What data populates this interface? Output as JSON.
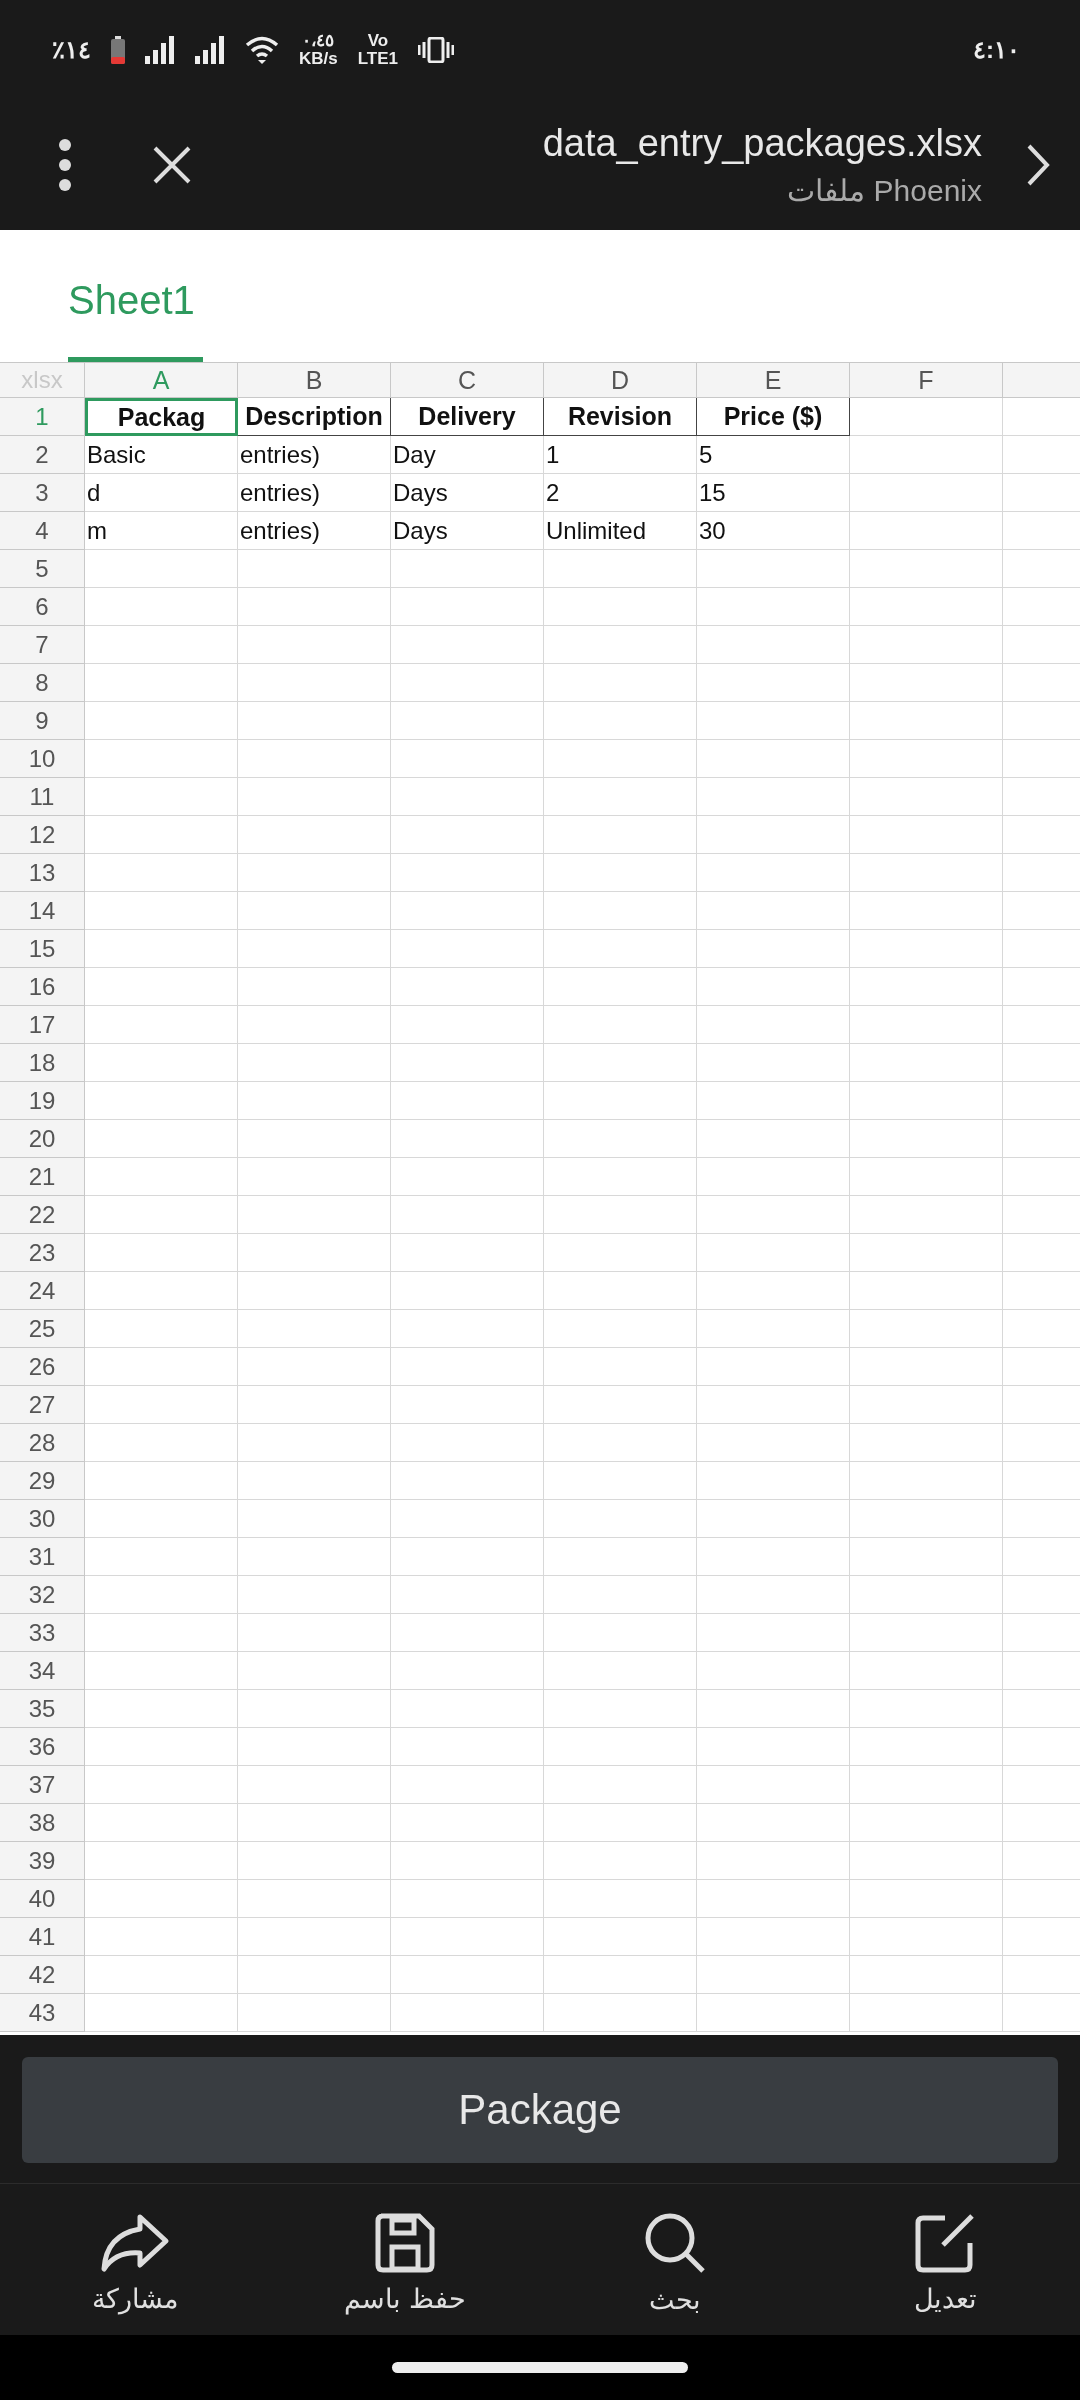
{
  "status_bar": {
    "battery_percent": "٪١٤",
    "speed": "٠،٤٥",
    "speed_unit": "KB/s",
    "volte_label": "Vo",
    "network_label": "LTE1",
    "time": "٤:١٠"
  },
  "header": {
    "title": "data_entry_packages.xlsx",
    "subtitle": "ملفات Phoenix"
  },
  "sheet_tabs": [
    {
      "label": "Sheet1",
      "selected": true
    }
  ],
  "grid": {
    "corner": "xlsx",
    "columns": [
      {
        "label": "A",
        "selected": true
      },
      {
        "label": "B",
        "selected": false
      },
      {
        "label": "C",
        "selected": false
      },
      {
        "label": "D",
        "selected": false
      },
      {
        "label": "E",
        "selected": false
      },
      {
        "label": "F",
        "selected": false
      }
    ],
    "rows": [
      {
        "number": "1",
        "selected": true,
        "kind": "header",
        "cells": [
          "Packag",
          "Description",
          "Delivery",
          "Revision",
          "Price ($)"
        ]
      },
      {
        "number": "2",
        "selected": false,
        "kind": "data",
        "cells": [
          "Basic",
          "entries)",
          "Day",
          "1",
          "5"
        ]
      },
      {
        "number": "3",
        "selected": false,
        "kind": "data",
        "cells": [
          "d",
          "entries)",
          "Days",
          "2",
          "15"
        ]
      },
      {
        "number": "4",
        "selected": false,
        "kind": "data",
        "cells": [
          "m",
          "entries)",
          "Days",
          "Unlimited",
          "30"
        ]
      },
      {
        "number": "5",
        "selected": false
      },
      {
        "number": "6",
        "selected": false
      },
      {
        "number": "7",
        "selected": false
      },
      {
        "number": "8",
        "selected": false
      },
      {
        "number": "9",
        "selected": false
      },
      {
        "number": "10",
        "selected": false
      },
      {
        "number": "11",
        "selected": false
      },
      {
        "number": "12",
        "selected": false
      },
      {
        "number": "13",
        "selected": false
      },
      {
        "number": "14",
        "selected": false
      },
      {
        "number": "15",
        "selected": false
      },
      {
        "number": "16",
        "selected": false
      },
      {
        "number": "17",
        "selected": false
      },
      {
        "number": "18",
        "selected": false
      },
      {
        "number": "19",
        "selected": false
      },
      {
        "number": "20",
        "selected": false
      },
      {
        "number": "21",
        "selected": false
      },
      {
        "number": "22",
        "selected": false
      },
      {
        "number": "23",
        "selected": false
      },
      {
        "number": "24",
        "selected": false
      },
      {
        "number": "25",
        "selected": false
      },
      {
        "number": "26",
        "selected": false
      },
      {
        "number": "27",
        "selected": false
      },
      {
        "number": "28",
        "selected": false
      },
      {
        "number": "29",
        "selected": false
      },
      {
        "number": "30",
        "selected": false
      },
      {
        "number": "31",
        "selected": false
      },
      {
        "number": "32",
        "selected": false
      },
      {
        "number": "33",
        "selected": false
      },
      {
        "number": "34",
        "selected": false
      },
      {
        "number": "35",
        "selected": false
      },
      {
        "number": "36",
        "selected": false
      },
      {
        "number": "37",
        "selected": false
      },
      {
        "number": "38",
        "selected": false
      },
      {
        "number": "39",
        "selected": false
      },
      {
        "number": "40",
        "selected": false
      },
      {
        "number": "41",
        "selected": false
      },
      {
        "number": "42",
        "selected": false
      },
      {
        "number": "43",
        "selected": false
      }
    ]
  },
  "cell_preview": {
    "label": "Package"
  },
  "toolbar": [
    {
      "kind": "edit",
      "label": "تعديل"
    },
    {
      "kind": "search",
      "label": "بحث"
    },
    {
      "kind": "save",
      "label": "حفظ باسم"
    },
    {
      "kind": "share",
      "label": "مشاركة"
    }
  ]
}
